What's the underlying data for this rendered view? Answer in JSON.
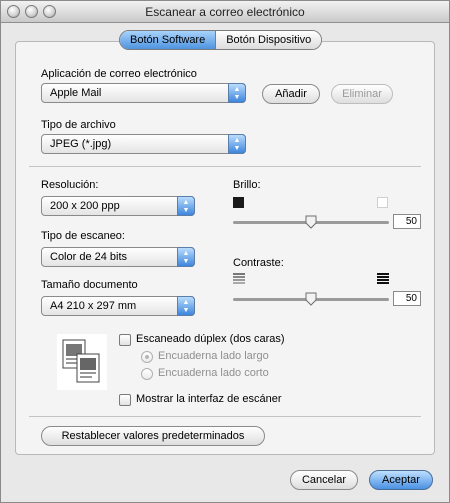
{
  "window": {
    "title": "Escanear a correo electrónico"
  },
  "tabs": [
    {
      "label": "Botón Software",
      "active": true
    },
    {
      "label": "Botón Dispositivo",
      "active": false
    }
  ],
  "email_app": {
    "label": "Aplicación de correo electrónico",
    "value": "Apple Mail",
    "add_label": "Añadir",
    "remove_label": "Eliminar"
  },
  "file_type": {
    "label": "Tipo de archivo",
    "value": "JPEG (*.jpg)"
  },
  "resolution": {
    "label": "Resolución:",
    "value": "200 x 200 ppp"
  },
  "scan_type": {
    "label": "Tipo de escaneo:",
    "value": "Color de 24 bits"
  },
  "doc_size": {
    "label": "Tamaño documento",
    "value": "A4  210 x 297 mm"
  },
  "brightness": {
    "label": "Brillo:",
    "value": "50",
    "level": 0.5
  },
  "contrast": {
    "label": "Contraste:",
    "value": "50",
    "level": 0.5
  },
  "duplex": {
    "label": "Escaneado dúplex (dos caras)",
    "checked": false,
    "long_edge": "Encuaderna lado largo",
    "short_edge": "Encuaderna lado corto"
  },
  "show_scanner_ui": {
    "label": "Mostrar la interfaz de escáner",
    "checked": false
  },
  "reset_label": "Restablecer valores predeterminados",
  "cancel_label": "Cancelar",
  "ok_label": "Aceptar",
  "colors": {
    "accent": "#4a91e4"
  }
}
